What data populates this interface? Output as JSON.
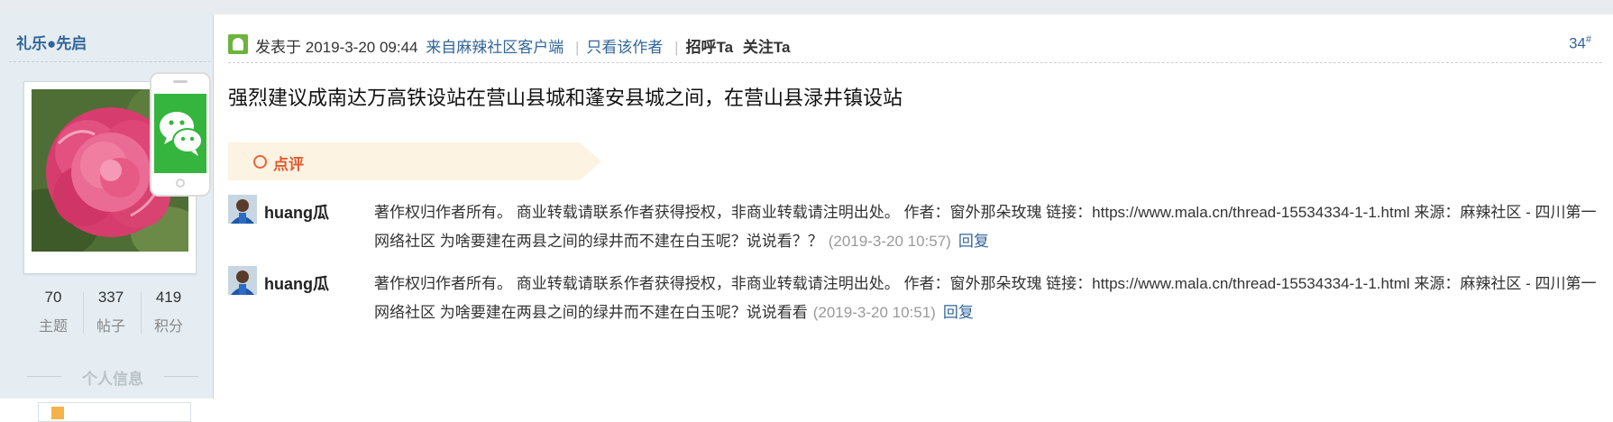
{
  "author": {
    "name": "礼乐●先启",
    "stats": [
      {
        "value": "70",
        "label": "主题"
      },
      {
        "value": "337",
        "label": "帖子"
      },
      {
        "value": "419",
        "label": "积分"
      }
    ],
    "profile_label": "个人信息",
    "wechat_icon": "wechat-icon",
    "avatar_subject": "pink peony flower"
  },
  "post": {
    "posted_prefix": "发表于",
    "posted_time": "2019-3-20 09:44",
    "source_link": "来自麻辣社区客户端",
    "only_author": "只看该作者",
    "greet": "招呼Ta",
    "follow": "关注Ta",
    "floor": "34",
    "floor_mark": "#",
    "body": "强烈建议成南达万高铁设站在营山县城和蓬安县城之间，在营山县渌井镇设站"
  },
  "comment_bar": {
    "label": "点评"
  },
  "replies": [
    {
      "user": "huang瓜",
      "text": "著作权归作者所有。 商业转载请联系作者获得授权，非商业转载请注明出处。 作者：窗外那朵玫瑰 链接：https://www.mala.cn/thread-15534334-1-1.html 来源：麻辣社区 - 四川第一网络社区 为啥要建在两县之间的绿井而不建在白玉呢？说说看？？",
      "time": "(2019-3-20 10:57)",
      "reply_label": "回复"
    },
    {
      "user": "huang瓜",
      "text": "著作权归作者所有。 商业转载请联系作者获得授权，非商业转载请注明出处。 作者：窗外那朵玫瑰 链接：https://www.mala.cn/thread-15534334-1-1.html 来源：麻辣社区 - 四川第一网络社区 为啥要建在两县之间的绿井而不建在白玉呢？说说看看",
      "time": "(2019-3-20 10:51)",
      "reply_label": "回复"
    }
  ],
  "colors": {
    "link": "#336699",
    "sidebar_bg": "#e5edf2",
    "comment_bg": "#fdf3e2",
    "comment_accent": "#e05a2e",
    "wechat_green": "#35b53d"
  }
}
